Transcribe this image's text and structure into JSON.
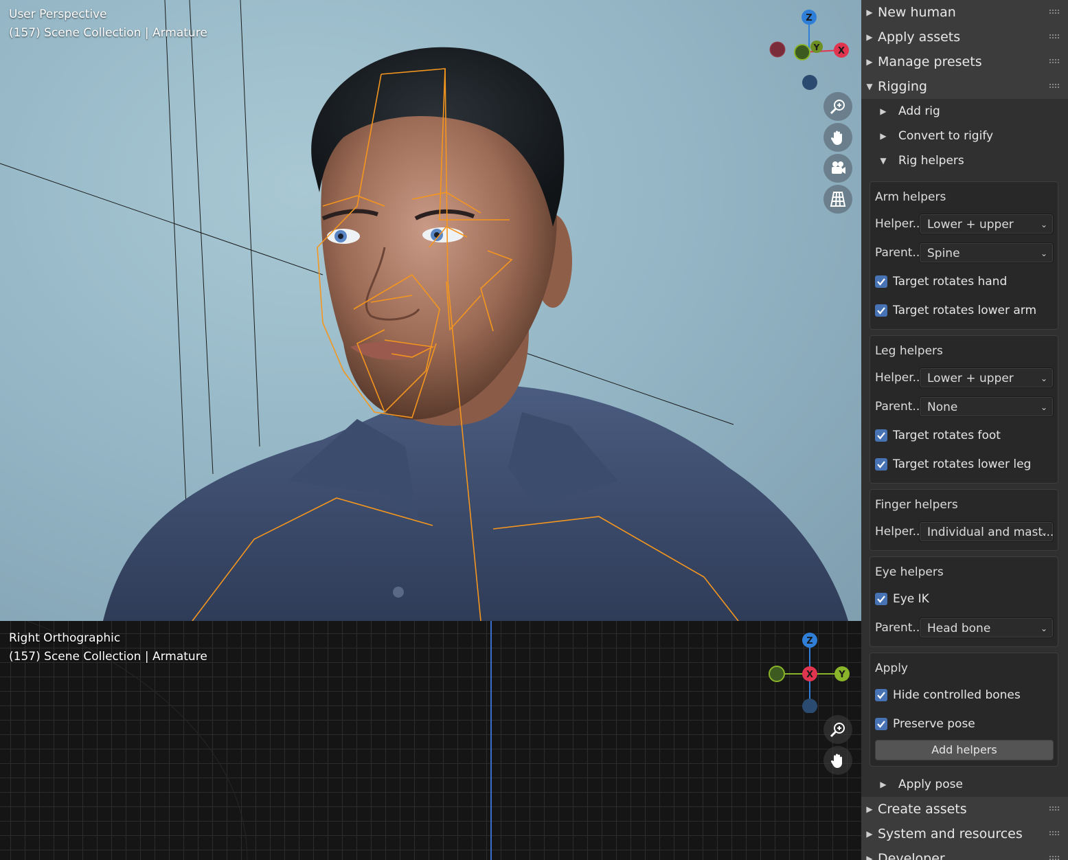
{
  "viewport_top": {
    "line1": "User Perspective",
    "line2": "(157) Scene Collection | Armature"
  },
  "viewport_bottom": {
    "line1": "Right Orthographic",
    "line2": "(157) Scene Collection | Armature"
  },
  "gizmo_top": {
    "z": "Z",
    "y": "Y",
    "x": "X"
  },
  "gizmo_bottom": {
    "z": "Z",
    "x": "X",
    "y": "Y"
  },
  "icons": {
    "zoom": "zoom-icon",
    "pan": "hand-icon",
    "camera": "camera-icon",
    "grid": "grid-icon"
  },
  "colors": {
    "accent_blue": "#4772b3",
    "axis_x": "#e0344f",
    "axis_y": "#8ab52a",
    "axis_z": "#2f7fd8",
    "bone_orange": "#f5961e"
  },
  "sidebar": {
    "panels": [
      {
        "label": "New human"
      },
      {
        "label": "Apply assets"
      },
      {
        "label": "Manage presets"
      },
      {
        "label": "Rigging"
      }
    ],
    "rigging_items": [
      {
        "label": "Add rig"
      },
      {
        "label": "Convert to rigify"
      },
      {
        "label": "Rig helpers"
      }
    ],
    "arm": {
      "title": "Arm helpers",
      "helper_label": "Helper...",
      "helper_value": "Lower + upper",
      "parent_label": "Parent...",
      "parent_value": "Spine",
      "check1": "Target rotates hand",
      "check2": "Target rotates lower arm"
    },
    "leg": {
      "title": "Leg helpers",
      "helper_label": "Helper...",
      "helper_value": "Lower + upper",
      "parent_label": "Parent...",
      "parent_value": "None",
      "check1": "Target rotates foot",
      "check2": "Target rotates lower leg"
    },
    "finger": {
      "title": "Finger helpers",
      "helper_label": "Helper...",
      "helper_value": "Individual and mast..."
    },
    "eye": {
      "title": "Eye helpers",
      "check1": "Eye IK",
      "parent_label": "Parent...",
      "parent_value": "Head bone"
    },
    "apply": {
      "title": "Apply",
      "check1": "Hide controlled bones",
      "check2": "Preserve pose",
      "button": "Add helpers"
    },
    "apply_pose": "Apply pose",
    "bottom_panels": [
      {
        "label": "Create assets"
      },
      {
        "label": "System and resources"
      },
      {
        "label": "Developer"
      }
    ]
  }
}
